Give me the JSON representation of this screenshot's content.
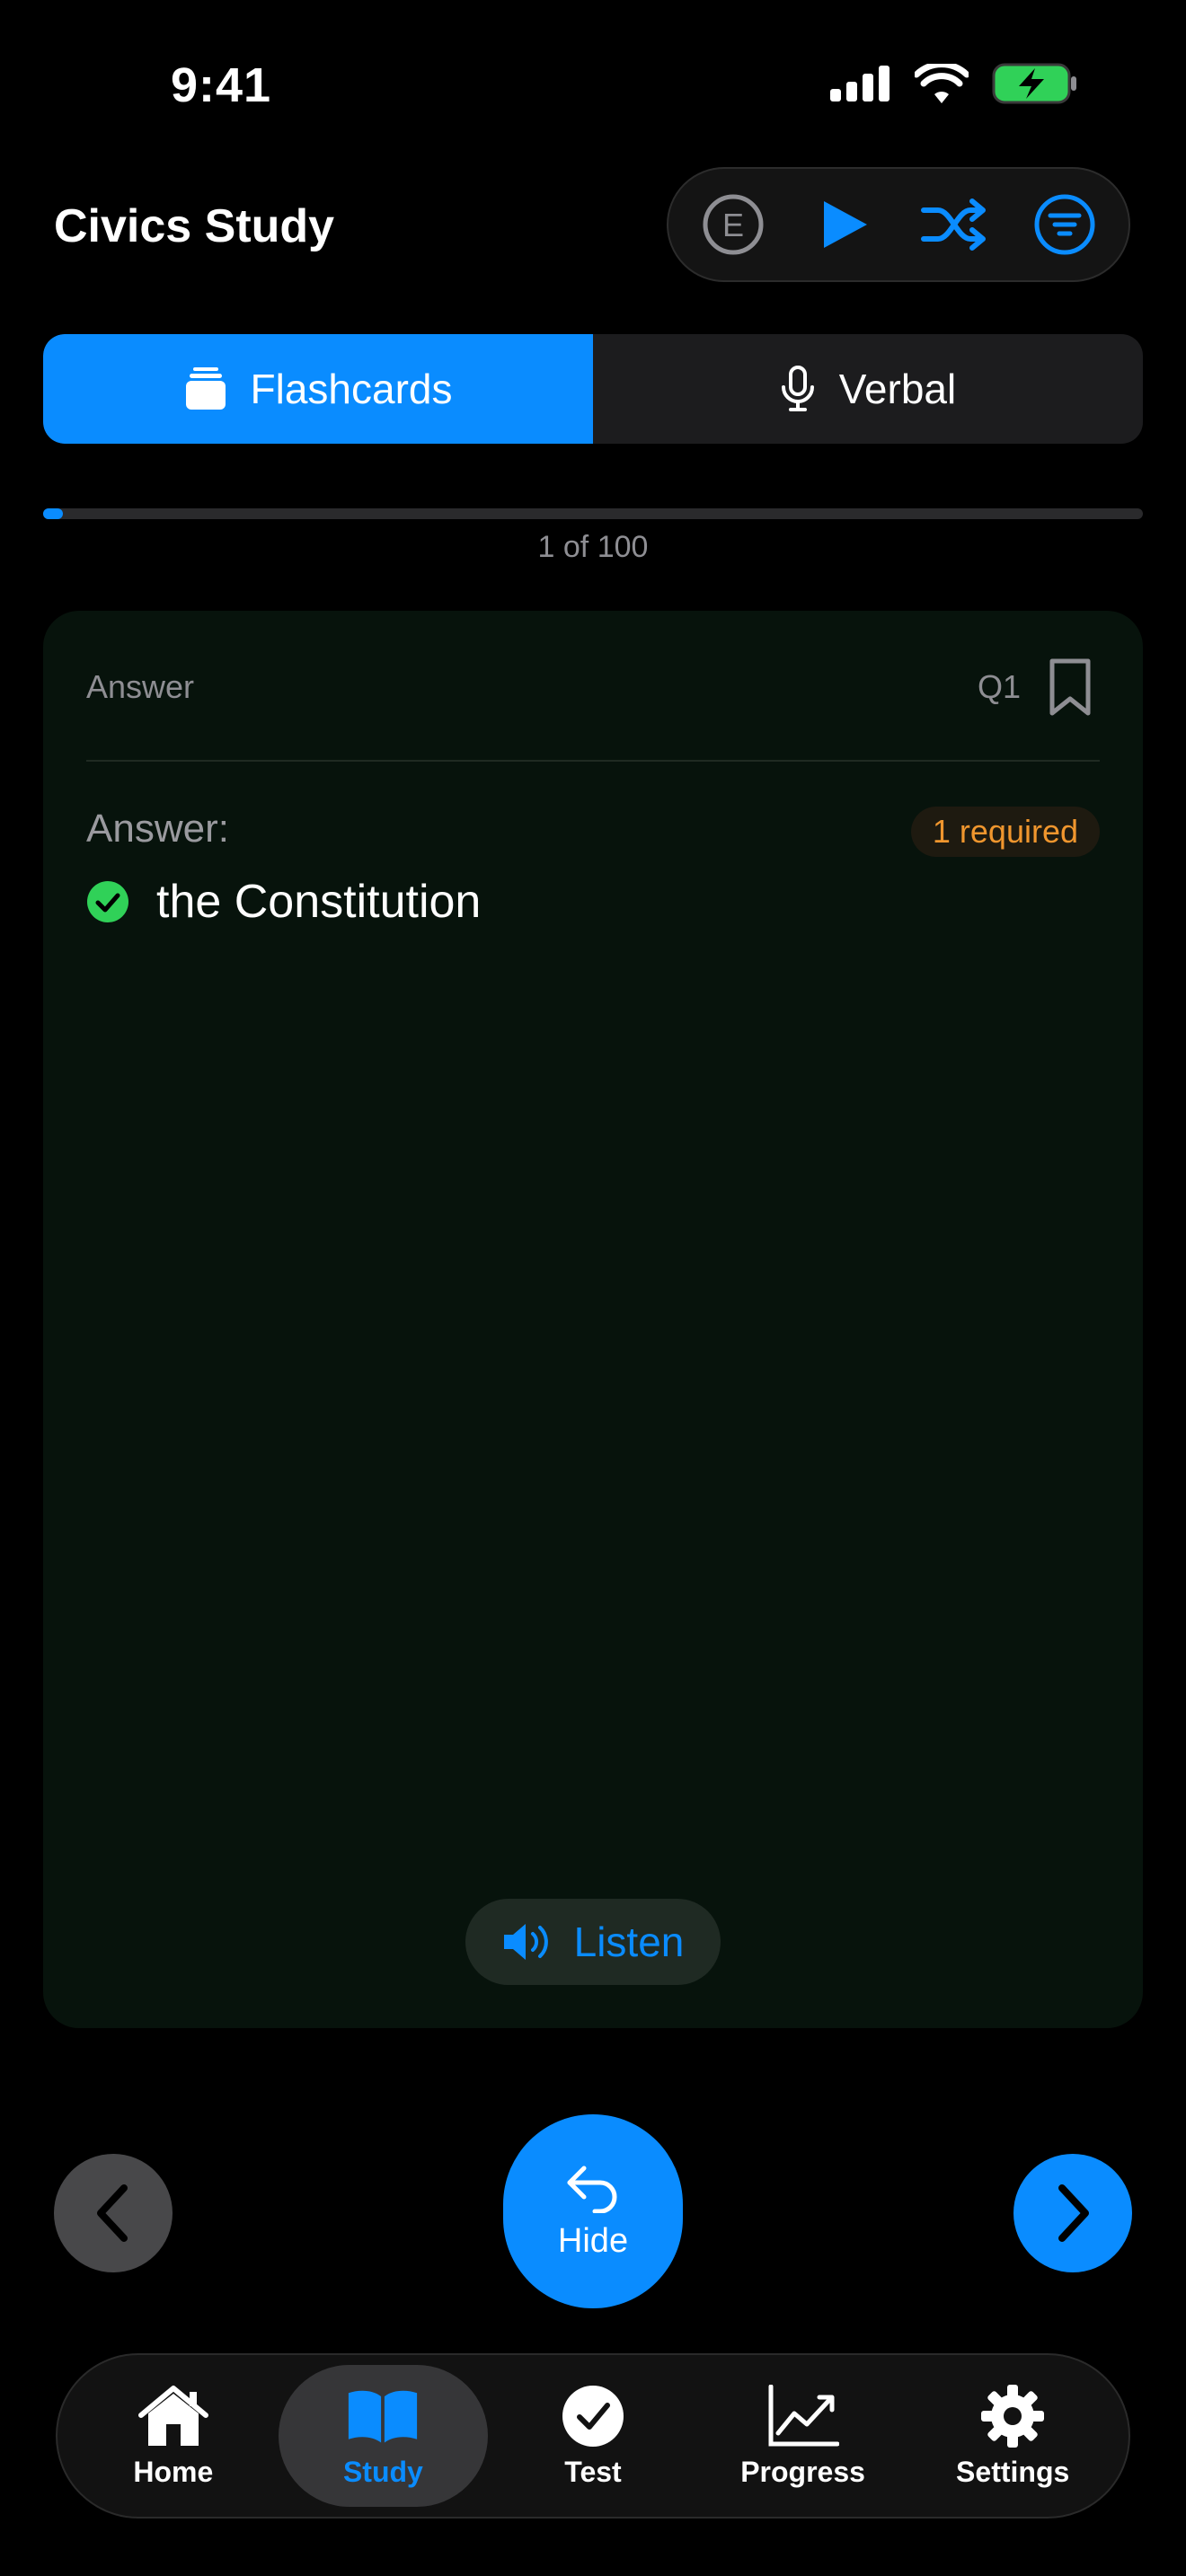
{
  "status_bar": {
    "time": "9:41"
  },
  "header": {
    "title": "Civics Study",
    "toolbar": {
      "language_letter": "E"
    }
  },
  "mode_tabs": [
    {
      "label": "Flashcards",
      "icon": "cards-stack-icon",
      "active": true
    },
    {
      "label": "Verbal",
      "icon": "microphone-icon",
      "active": false
    }
  ],
  "progress": {
    "label": "1 of 100",
    "current": 1,
    "total": 100
  },
  "card": {
    "side_label": "Answer",
    "question_number": "Q1",
    "answer_heading": "Answer:",
    "required_badge": "1 required",
    "answers": [
      "the Constitution"
    ],
    "listen_label": "Listen"
  },
  "controls": {
    "hide_label": "Hide"
  },
  "tabbar": [
    {
      "label": "Home",
      "icon": "home-icon",
      "active": false
    },
    {
      "label": "Study",
      "icon": "book-icon",
      "active": true
    },
    {
      "label": "Test",
      "icon": "checkmark-circle-icon",
      "active": false
    },
    {
      "label": "Progress",
      "icon": "chart-line-icon",
      "active": false
    },
    {
      "label": "Settings",
      "icon": "gear-icon",
      "active": false
    }
  ],
  "colors": {
    "accent": "#0a8cff",
    "background": "#000000",
    "card_background": "#07130c",
    "success": "#30d158",
    "warning": "#f0962e"
  }
}
